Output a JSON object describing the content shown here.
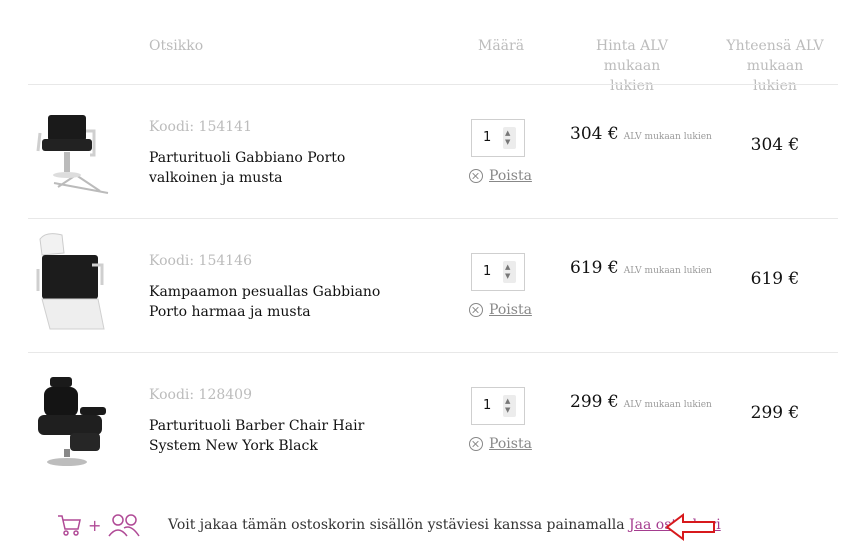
{
  "header": {
    "title_col": "Otsikko",
    "qty_col": "Määrä",
    "price_col": "Hinta ALV mukaan lukien",
    "total_col": "Yhteensä ALV mukaan lukien"
  },
  "items": [
    {
      "code": "Koodi: 154141",
      "name": "Parturituoli Gabbiano Porto valkoinen ja musta",
      "quantity": "1",
      "remove_label": "Poista",
      "price": "304 €",
      "price_note": "ALV mukaan lukien",
      "total": "304 €",
      "image": "barber-chair-white-black"
    },
    {
      "code": "Koodi: 154146",
      "name": "Kampaamon pesuallas Gabbiano Porto harmaa ja musta",
      "quantity": "1",
      "remove_label": "Poista",
      "price": "619 €",
      "price_note": "ALV mukaan lukien",
      "total": "619 €",
      "image": "wash-basin-chair"
    },
    {
      "code": "Koodi: 128409",
      "name": "Parturituoli Barber Chair Hair System New York Black",
      "quantity": "1",
      "remove_label": "Poista",
      "price": "299 €",
      "price_note": "ALV mukaan lukien",
      "total": "299 €",
      "image": "barber-chair-black"
    }
  ],
  "share": {
    "text": "Voit jakaa tämän ostoskorin sisällön ystäviesi kanssa painamalla ",
    "link": "Jaa ostoskori",
    "plus": "+",
    "icons": [
      "cart-icon",
      "people-icon"
    ]
  },
  "colors": {
    "accent": "#a53d8f",
    "arrow": "#d7191c",
    "muted": "#bcbcbc"
  }
}
